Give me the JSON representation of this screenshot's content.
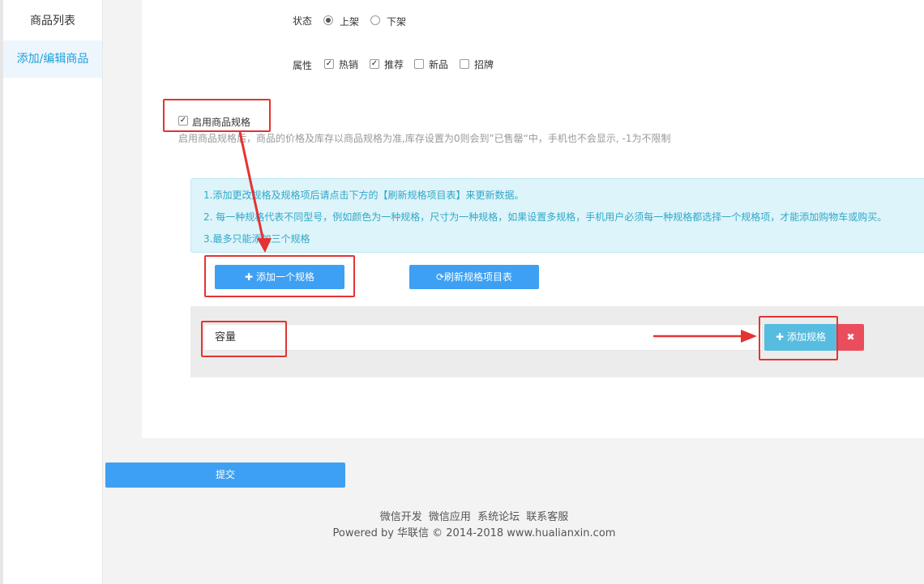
{
  "sidebar": {
    "items": [
      {
        "label": "商品列表"
      },
      {
        "label": "添加/编辑商品"
      }
    ]
  },
  "form": {
    "status": {
      "label": "状态",
      "options": [
        {
          "label": "上架",
          "checked": true
        },
        {
          "label": "下架",
          "checked": false
        }
      ]
    },
    "attrs": {
      "label": "属性",
      "options": [
        {
          "label": "热销",
          "checked": true
        },
        {
          "label": "推荐",
          "checked": true
        },
        {
          "label": "新品",
          "checked": false
        },
        {
          "label": "招牌",
          "checked": false
        }
      ]
    },
    "enable_spec": {
      "label": "启用商品规格",
      "checked": true,
      "help": "启用商品规格后，商品的价格及库存以商品规格为准,库存设置为0则会到”已售罄“中，手机也不会显示, -1为不限制"
    },
    "notice": [
      "1.添加更改规格及规格项后请点击下方的【刷新规格项目表】来更新数据。",
      "2. 每一种规格代表不同型号，例如颜色为一种规格，尺寸为一种规格，如果设置多规格，手机用户必须每一种规格都选择一个规格项，才能添加购物车或购买。",
      "3.最多只能添加三个规格"
    ],
    "buttons": {
      "add_spec": "添加一个规格",
      "refresh": "刷新规格项目表",
      "add_item": "添加规格",
      "submit": "提交"
    },
    "spec": {
      "name_value": "容量"
    }
  },
  "footer": {
    "links": [
      "微信开发",
      "微信应用",
      "系统论坛",
      "联系客服"
    ],
    "copyright": "Powered by 华联信 © 2014-2018 www.hualianxin.com"
  },
  "colors": {
    "primary": "#3ea0f2",
    "accent_cyan": "#56bde0",
    "danger": "#ea4e5c",
    "annotation": "#e53333",
    "notice_text": "#31a8c8"
  }
}
